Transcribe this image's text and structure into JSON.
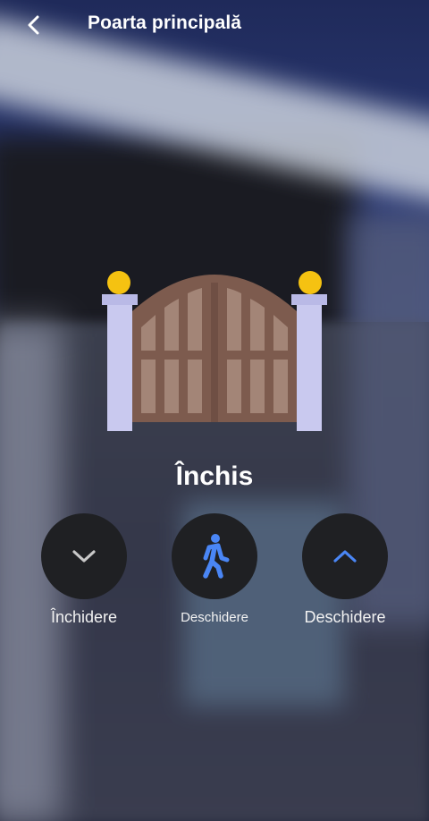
{
  "header": {
    "title": "Poarta principală"
  },
  "gate": {
    "status": "Închis"
  },
  "controls": [
    {
      "label": "Închidere",
      "icon": "chevron-down-icon",
      "icon_color": "#c8c8c8"
    },
    {
      "label": "Deschidere",
      "icon": "pedestrian-icon",
      "icon_color": "#4a86f5"
    },
    {
      "label": "Deschidere",
      "icon": "chevron-up-icon",
      "icon_color": "#4a86f5"
    }
  ],
  "colors": {
    "button_bg": "#1f2023",
    "accent": "#4a86f5",
    "gate_wood": "#7d5b4e",
    "gate_slat": "#a38577",
    "post": "#c9c9ef",
    "lamp": "#f5c211"
  }
}
